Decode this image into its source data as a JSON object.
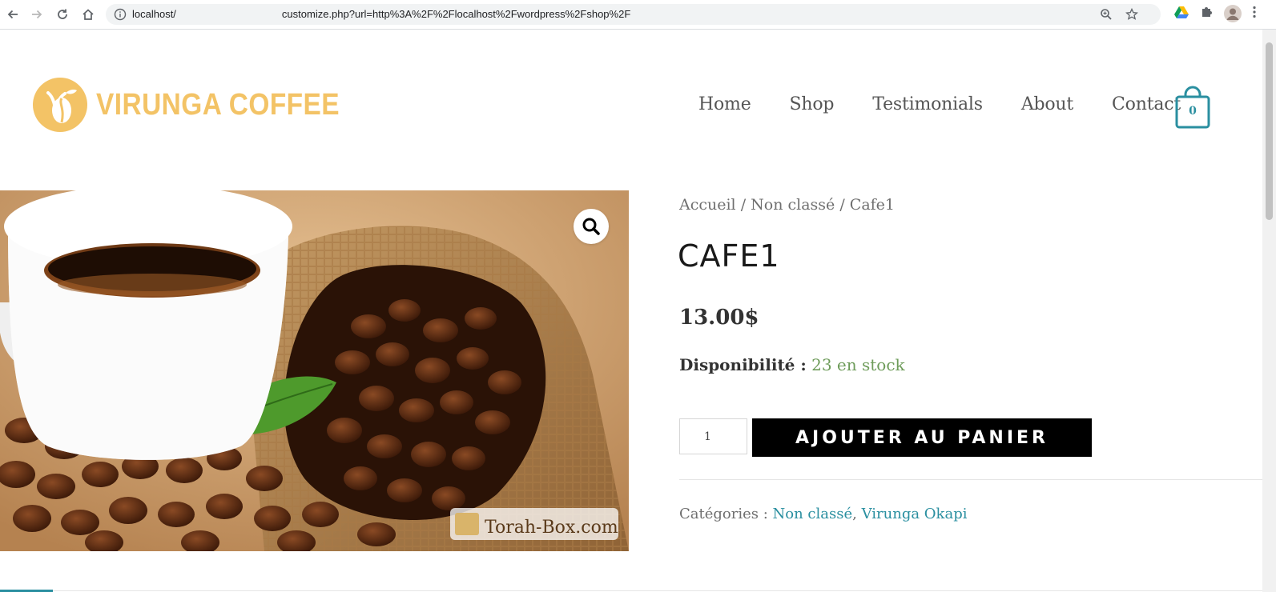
{
  "browser": {
    "url_prefix": "localhost/",
    "url_suffix": "customize.php?url=http%3A%2F%2Flocalhost%2Fwordpress%2Fshop%2F"
  },
  "site": {
    "logo_text": "VIRUNGA COFFEE",
    "nav": [
      "Home",
      "Shop",
      "Testimonials",
      "About",
      "Contact"
    ],
    "cart_count": "0"
  },
  "product": {
    "breadcrumb": [
      "Accueil",
      "Non classé",
      "Cafe1"
    ],
    "title": "CAFE1",
    "price": "13.00$",
    "availability_label": "Disponibilité :",
    "availability_value": "23 en stock",
    "quantity": "1",
    "add_to_cart": "AJOUTER AU PANIER",
    "categories_label": "Catégories :",
    "categories": [
      "Non classé",
      "Virunga Okapi"
    ],
    "watermark": "Torah-Box.com"
  },
  "colors": {
    "brand": "#f3c366",
    "accent": "#2a8fa0",
    "stock": "#6e9c5a"
  },
  "icons": [
    "back-arrow-icon",
    "forward-arrow-icon",
    "reload-icon",
    "home-icon",
    "info-icon",
    "zoom-icon",
    "star-icon",
    "drive-icon",
    "puzzle-icon",
    "avatar",
    "more-icon",
    "cart-bag-icon",
    "magnifier-icon"
  ]
}
